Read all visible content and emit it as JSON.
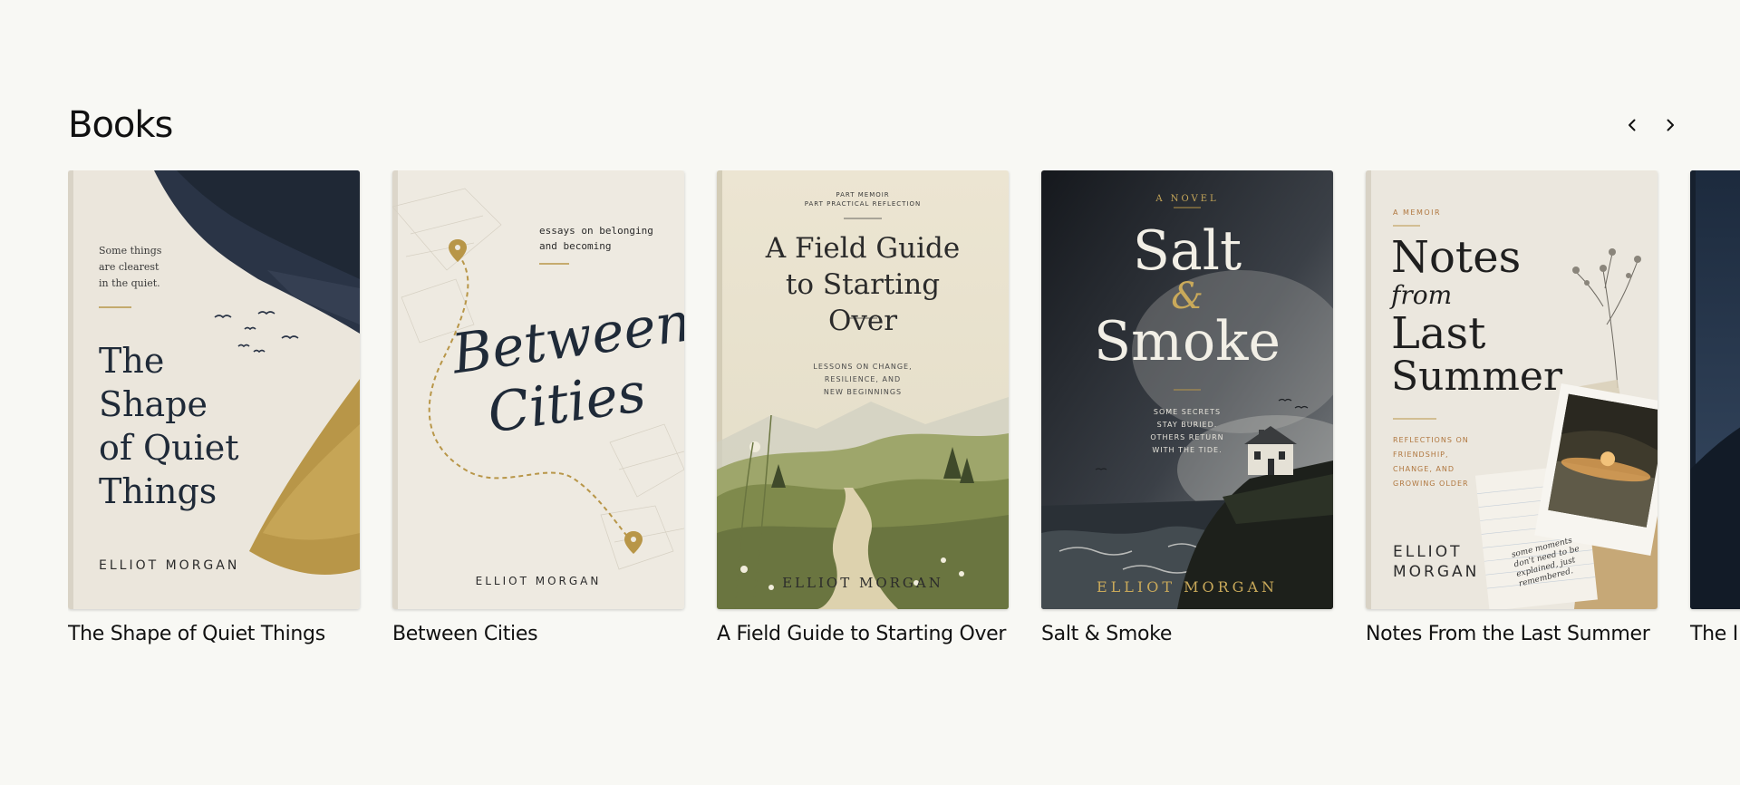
{
  "section": {
    "title": "Books",
    "prev_label": "Previous",
    "next_label": "Next"
  },
  "books": [
    {
      "title": "The Shape of Quiet Things",
      "cover": {
        "tagline": [
          "Some things",
          "are clearest",
          "in the quiet."
        ],
        "title_lines": [
          "The",
          "Shape",
          "of Quiet",
          "Things"
        ],
        "author": "ELLIOT MORGAN"
      }
    },
    {
      "title": "Between Cities",
      "cover": {
        "tagline": [
          "essays on belonging",
          "and becoming"
        ],
        "title_lines": [
          "Between",
          "Cities"
        ],
        "author": "ELLIOT MORGAN"
      }
    },
    {
      "title": "A Field Guide to Starting Over",
      "cover": {
        "kicker": [
          "PART MEMOIR",
          "PART PRACTICAL REFLECTION"
        ],
        "title_lines": [
          "A Field Guide",
          "to Starting",
          "Over"
        ],
        "subtitle": [
          "LESSONS ON CHANGE,",
          "RESILIENCE, AND",
          "NEW BEGINNINGS"
        ],
        "author": "ELLIOT MORGAN"
      }
    },
    {
      "title": "Salt & Smoke",
      "cover": {
        "kicker": "A NOVEL",
        "title_lines": [
          "Salt",
          "&",
          "Smoke"
        ],
        "tagline": [
          "SOME SECRETS",
          "STAY BURIED.",
          "OTHERS RETURN",
          "WITH THE TIDE."
        ],
        "author": "ELLIOT MORGAN"
      }
    },
    {
      "title": "Notes From the Last Summer",
      "cover": {
        "kicker": "A MEMOIR",
        "title_lines": [
          "Notes",
          "from",
          "Last",
          "Summer"
        ],
        "subtitle": [
          "REFLECTIONS ON",
          "FRIENDSHIP,",
          "CHANGE, AND",
          "GROWING OLDER"
        ],
        "author_lines": [
          "ELLIOT",
          "MORGAN"
        ],
        "note": [
          "some moments",
          "don't need to be",
          "explained, just",
          "remembered."
        ]
      }
    },
    {
      "title": "The I",
      "cover": {}
    }
  ],
  "colors": {
    "background": "#f8f8f4",
    "text": "#111111",
    "accent_gold": "#b89648",
    "navy": "#1f2a38"
  },
  "icons": {
    "prev": "chevron-left-icon",
    "next": "chevron-right-icon"
  }
}
